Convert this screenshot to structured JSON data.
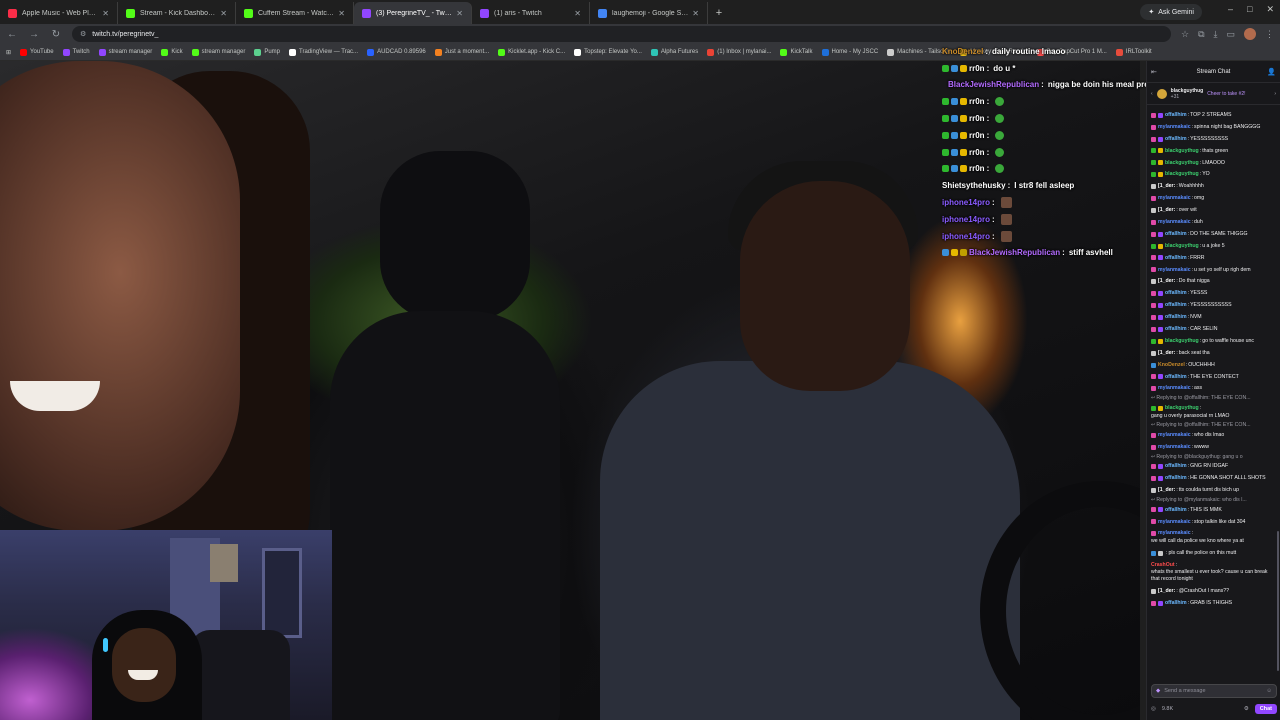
{
  "browser": {
    "tabs": [
      {
        "title": "Apple Music - Web Player",
        "color": "#fa2d48",
        "active": false
      },
      {
        "title": "Stream - Kick Dashboard",
        "color": "#53fc18",
        "active": false
      },
      {
        "title": "Cuffem Stream - Watch Live o",
        "color": "#53fc18",
        "active": false
      },
      {
        "title": "(3) PeregrineTV_ - Twitch",
        "color": "#9146ff",
        "active": true
      },
      {
        "title": "(1) aris - Twitch",
        "color": "#9146ff",
        "active": false
      },
      {
        "title": "laughemoji - Google Search",
        "color": "#4285f4",
        "active": false
      }
    ],
    "new_tab": "+",
    "gemini_label": "Ask Gemini",
    "url": "twitch.tv/peregrinetv_",
    "bookmarks": [
      {
        "label": "YouTube",
        "color": "#ff0000"
      },
      {
        "label": "Twitch",
        "color": "#9146ff"
      },
      {
        "label": "stream manager",
        "color": "#9146ff"
      },
      {
        "label": "Kick",
        "color": "#53fc18"
      },
      {
        "label": "stream manager",
        "color": "#53fc18"
      },
      {
        "label": "Pump",
        "color": "#5cd18f"
      },
      {
        "label": "TradingView — Trac...",
        "color": "#ffffff"
      },
      {
        "label": "AUDCAD 0.89596",
        "color": "#2962ff"
      },
      {
        "label": "Just a moment...",
        "color": "#f48120"
      },
      {
        "label": "Kicklet.app - Kick C...",
        "color": "#53fc18"
      },
      {
        "label": "Topstep: Elevate Yo...",
        "color": "#ffffff"
      },
      {
        "label": "Alpha Futures",
        "color": "#2ec4b6"
      },
      {
        "label": "(1) Inbox | mylanai...",
        "color": "#ea4335"
      },
      {
        "label": "KickTalk",
        "color": "#53fc18"
      },
      {
        "label": "Home - My JSCC",
        "color": "#1e6fd9"
      },
      {
        "label": "Machines - Tailscale",
        "color": "#cccccc"
      },
      {
        "label": "Monkey: Free Rand...",
        "color": "#f5c518"
      },
      {
        "label": "Buy CapCut Pro 1 M...",
        "color": "#ff4d4d"
      },
      {
        "label": "IRLToolkit",
        "color": "#e74c3c"
      }
    ]
  },
  "overlay": [
    {
      "user": "KnoDenzel",
      "msg": "daily routine lmaoo",
      "color": "#c88a2a",
      "badges": []
    },
    {
      "user": "rr0n",
      "msg": "do u *",
      "color": "#ffffff",
      "badges": [
        "#2eb82e",
        "#3a8fd8",
        "#e6b800"
      ]
    },
    {
      "user": "BlackJewishRepublican",
      "msg": "nigga be doin his meal prep",
      "color": "#b36bff",
      "badges": [
        "#3a8fd8",
        "#e6b800",
        "#c0a000"
      ]
    },
    {
      "user": "rr0n",
      "msg": "",
      "color": "#ffffff",
      "badges": [
        "#2eb82e",
        "#3a8fd8",
        "#e6b800"
      ],
      "emote": true
    },
    {
      "user": "rr0n",
      "msg": "",
      "color": "#ffffff",
      "badges": [
        "#2eb82e",
        "#3a8fd8",
        "#e6b800"
      ],
      "emote": true
    },
    {
      "user": "rr0n",
      "msg": "",
      "color": "#ffffff",
      "badges": [
        "#2eb82e",
        "#3a8fd8",
        "#e6b800"
      ],
      "emote": true
    },
    {
      "user": "rr0n",
      "msg": "",
      "color": "#ffffff",
      "badges": [
        "#2eb82e",
        "#3a8fd8",
        "#e6b800"
      ],
      "emote": true
    },
    {
      "user": "rr0n",
      "msg": "",
      "color": "#ffffff",
      "badges": [
        "#2eb82e",
        "#3a8fd8",
        "#e6b800"
      ],
      "emote": true
    },
    {
      "user": "Shietsythehusky",
      "msg": "I str8 fell asleep",
      "color": "#ffffff",
      "badges": []
    },
    {
      "user": "iphone14pro",
      "msg": "",
      "color": "#8a5cff",
      "badges": [],
      "pic": true
    },
    {
      "user": "iphone14pro",
      "msg": "",
      "color": "#8a5cff",
      "badges": [],
      "pic": true
    },
    {
      "user": "iphone14pro",
      "msg": "",
      "color": "#8a5cff",
      "badges": [],
      "pic": true
    },
    {
      "user": "BlackJewishRepublican",
      "msg": "stiff asvhell",
      "color": "#b36bff",
      "badges": [
        "#3a8fd8",
        "#e6b800",
        "#c0a000"
      ]
    }
  ],
  "chat": {
    "header_title": "Stream Chat",
    "pinned_user": "blackguythug",
    "pinned_sub": "+31",
    "pinned_msg": "Cheer to take #2!",
    "messages": [
      {
        "user": "offallhim",
        "msg": "TOP 2 STREAMS",
        "color": "#6bb8ff",
        "badges": [
          "#e04aa8",
          "#9146ff"
        ]
      },
      {
        "user": "mylanmakaic",
        "msg": "spinna night bag BANGGGG",
        "color": "#5a8cff",
        "badges": [
          "#e04aa8"
        ]
      },
      {
        "user": "offallhim",
        "msg": "YESSSSSSSSS",
        "color": "#6bb8ff",
        "badges": [
          "#e04aa8",
          "#9146ff"
        ]
      },
      {
        "user": "blackguythug",
        "msg": "thats green",
        "color": "#3ccf6e",
        "badges": [
          "#2eb82e",
          "#e6b800"
        ]
      },
      {
        "user": "blackguythug",
        "msg": "LMAOOO",
        "color": "#3ccf6e",
        "badges": [
          "#2eb82e",
          "#e6b800"
        ]
      },
      {
        "user": "blackguythug",
        "msg": "YO",
        "color": "#3ccf6e",
        "badges": [
          "#2eb82e",
          "#e6b800"
        ]
      },
      {
        "user": "[1_der:",
        "msg": "Woahhhhh",
        "color": "#ffffff",
        "badges": [
          "#c9c9c9"
        ]
      },
      {
        "user": "mylanmakaic",
        "msg": "omg",
        "color": "#5a8cff",
        "badges": [
          "#e04aa8"
        ]
      },
      {
        "user": "[1_der:",
        "msg": "over wit",
        "color": "#ffffff",
        "badges": [
          "#c9c9c9"
        ]
      },
      {
        "user": "mylanmakaic",
        "msg": "duh",
        "color": "#5a8cff",
        "badges": [
          "#e04aa8"
        ]
      },
      {
        "user": "offallhim",
        "msg": "DO THE SAME THIGGG",
        "color": "#6bb8ff",
        "badges": [
          "#e04aa8",
          "#9146ff"
        ]
      },
      {
        "user": "blackguythug",
        "msg": "u a joke 5",
        "color": "#3ccf6e",
        "badges": [
          "#2eb82e",
          "#e6b800"
        ]
      },
      {
        "user": "offallhim",
        "msg": "FRRR",
        "color": "#6bb8ff",
        "badges": [
          "#e04aa8",
          "#9146ff"
        ]
      },
      {
        "user": "mylanmakaic",
        "msg": "u set yo self up righ dem",
        "color": "#5a8cff",
        "badges": [
          "#e04aa8"
        ]
      },
      {
        "user": "[1_der:",
        "msg": "Do that nigga",
        "color": "#ffffff",
        "badges": [
          "#c9c9c9"
        ]
      },
      {
        "user": "offallhim",
        "msg": "YESSS",
        "color": "#6bb8ff",
        "badges": [
          "#e04aa8",
          "#9146ff"
        ]
      },
      {
        "user": "offallhim",
        "msg": "YESSSSSSSSSS",
        "color": "#6bb8ff",
        "badges": [
          "#e04aa8",
          "#9146ff"
        ]
      },
      {
        "user": "offallhim",
        "msg": "NVM",
        "color": "#6bb8ff",
        "badges": [
          "#e04aa8",
          "#9146ff"
        ]
      },
      {
        "user": "offallhim",
        "msg": "CAR SELIN",
        "color": "#6bb8ff",
        "badges": [
          "#e04aa8",
          "#9146ff"
        ]
      },
      {
        "user": "blackguythug",
        "msg": "go to waffle house unc",
        "color": "#3ccf6e",
        "badges": [
          "#2eb82e",
          "#e6b800"
        ]
      },
      {
        "user": "[1_der:",
        "msg": "back seat tha",
        "color": "#ffffff",
        "badges": [
          "#c9c9c9"
        ]
      },
      {
        "user": "KnoDenzel",
        "msg": "OUCHHHH",
        "color": "#c88a2a",
        "badges": [
          "#3a8fd8"
        ]
      },
      {
        "user": "offallhim",
        "msg": "THE EYE CONTECT",
        "color": "#6bb8ff",
        "badges": [
          "#e04aa8",
          "#9146ff"
        ]
      },
      {
        "user": "mylanmakaic",
        "msg": "ass",
        "color": "#5a8cff",
        "badges": [
          "#e04aa8"
        ]
      },
      {
        "reply": "Replying to @offallhim: THE EYE CON..."
      },
      {
        "user": "blackguythug",
        "msg": "gang u overly parasocial rn LMAO",
        "color": "#3ccf6e",
        "badges": [
          "#2eb82e",
          "#e6b800"
        ]
      },
      {
        "reply": "Replying to @offallhim: THE EYE CON..."
      },
      {
        "user": "mylanmakaic",
        "msg": "who dis lmao",
        "color": "#5a8cff",
        "badges": [
          "#e04aa8"
        ]
      },
      {
        "user": "mylanmakaic",
        "msg": "wwww",
        "color": "#5a8cff",
        "badges": [
          "#e04aa8"
        ]
      },
      {
        "reply": "Replying to @blackguythug: gang u o"
      },
      {
        "user": "offallhim",
        "msg": "GNG RN IDGAF",
        "color": "#6bb8ff",
        "badges": [
          "#e04aa8",
          "#9146ff"
        ]
      },
      {
        "user": "offallhim",
        "msg": "HE GONNA SHOT ALLL SHOTS",
        "color": "#6bb8ff",
        "badges": [
          "#e04aa8",
          "#9146ff"
        ]
      },
      {
        "user": "[1_der:",
        "msg": "tts coulda turnt dis bich up",
        "color": "#ffffff",
        "badges": [
          "#c9c9c9"
        ]
      },
      {
        "reply": "Replying to @mylanmakaic: who dis l..."
      },
      {
        "user": "offallhim",
        "msg": "THIS IS MMK",
        "color": "#6bb8ff",
        "badges": [
          "#e04aa8",
          "#9146ff"
        ]
      },
      {
        "user": "mylanmakaic",
        "msg": "stop talkin like dat 304",
        "color": "#5a8cff",
        "badges": [
          "#e04aa8"
        ]
      },
      {
        "user": "mylanmakaic",
        "msg": "we will call da police we kno where ya at",
        "color": "#5a8cff",
        "badges": [
          "#e04aa8"
        ]
      },
      {
        "user": "",
        "msg": "pls call the police on this mutt",
        "color": "#e03a3a",
        "badges": [
          "#3a8fd8",
          "#c9c9c9"
        ]
      },
      {
        "user": "CrashOut",
        "msg": "whats the smallest u ever took? cause u can break that record tonight",
        "color": "#ff4d4d",
        "badges": []
      },
      {
        "user": "[1_der:",
        "msg": "@CrashOut I mans??",
        "color": "#ffffff",
        "badges": [
          "#c9c9c9"
        ]
      },
      {
        "user": "offallhim",
        "msg": "GRAB IS THIGHS",
        "color": "#6bb8ff",
        "badges": [
          "#e04aa8",
          "#9146ff"
        ]
      }
    ],
    "input_placeholder": "Send a message",
    "viewer_count": "9.8K",
    "chat_button": "Chat"
  }
}
